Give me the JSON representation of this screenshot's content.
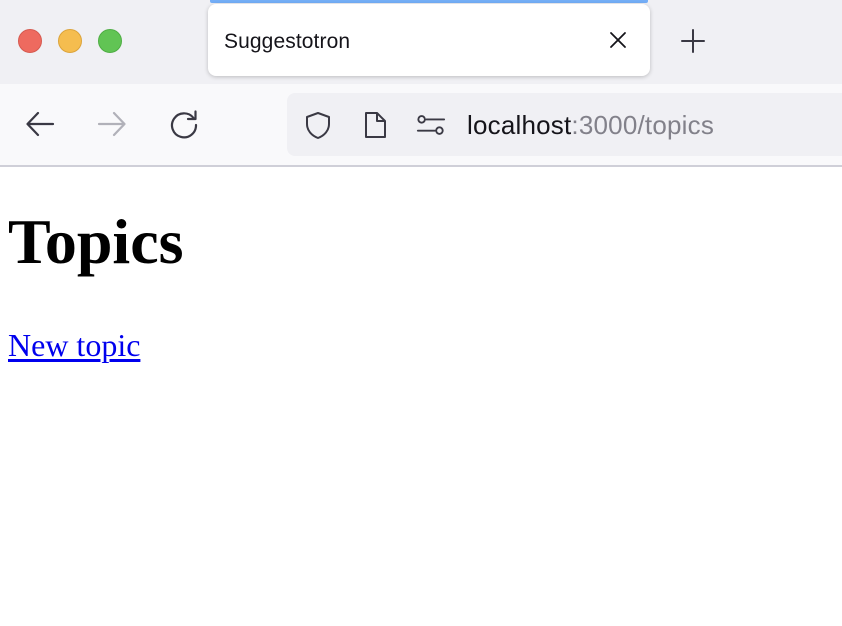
{
  "window": {
    "traffic_lights": [
      "close",
      "minimize",
      "maximize"
    ],
    "colors": {
      "close": "#ee6a5f",
      "minimize": "#f5bd4f",
      "maximize": "#61c454",
      "tab_accent": "#74aef7",
      "link": "#0000ee"
    }
  },
  "tabs": [
    {
      "title": "Suggestotron",
      "active": true,
      "close_icon": "close-icon"
    }
  ],
  "new_tab_icon": "plus-icon",
  "nav": {
    "back_icon": "arrow-left-icon",
    "forward_icon": "arrow-right-icon",
    "forward_enabled": false,
    "reload_icon": "reload-icon"
  },
  "urlbar": {
    "host": "localhost",
    "rest": ":3000/topics",
    "icons": [
      "shield-icon",
      "page-icon",
      "permissions-icon"
    ]
  },
  "page": {
    "heading": "Topics",
    "new_topic_link": "New topic"
  }
}
